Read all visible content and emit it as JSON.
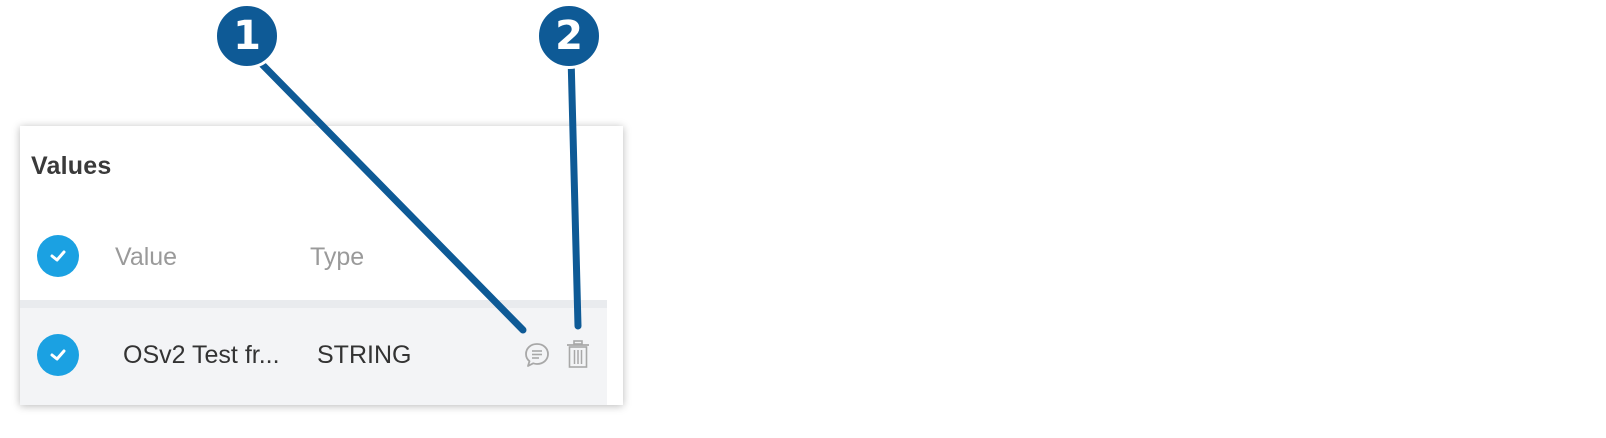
{
  "panel": {
    "title": "Values",
    "columns": {
      "value": "Value",
      "type": "Type"
    },
    "rows": [
      {
        "value": "OSv2 Test fr...",
        "type": "STRING"
      }
    ]
  },
  "callouts": [
    "1",
    "2"
  ],
  "colors": {
    "accent": "#1ba1e2",
    "callout": "#0e5a96",
    "row_bg": "#f3f4f6",
    "icon_gray": "#a8a8a8"
  },
  "icons": {
    "select_all": "check-circle-icon",
    "row_select": "check-circle-icon",
    "comment": "comment-icon",
    "delete": "trash-icon"
  }
}
